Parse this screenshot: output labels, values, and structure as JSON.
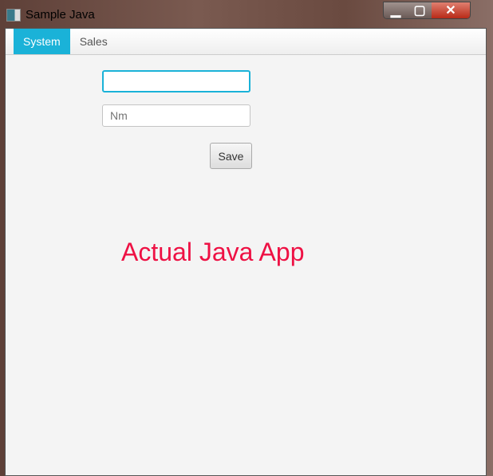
{
  "window": {
    "title": "Sample Java"
  },
  "tabs": [
    {
      "label": "System"
    },
    {
      "label": "Sales"
    }
  ],
  "form": {
    "field1_value": "",
    "field2_placeholder": "Nm",
    "save_label": "Save"
  },
  "annotation": "Actual Java App"
}
